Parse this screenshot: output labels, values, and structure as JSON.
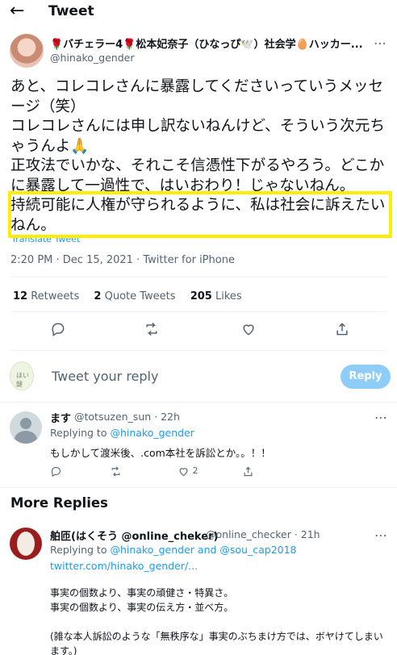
{
  "header": {
    "title": "Tweet",
    "back_icon": "back-arrow-icon"
  },
  "tweet": {
    "display_name": "🌹バチェラー4🌹松本妃奈子（ひなっぴ🕊️）社会学🥚ハッカー...",
    "handle": "@hinako_gender",
    "text_lines": [
      "あと、コレコレさんに暴露してくださいっていうメッセージ（笑）",
      "コレコレさんには申し訳ないねんけど、そういう次元ちゃうんよ🙏",
      "正攻法でいかな、それこそ信憑性下がるやろう。どこかに暴露して一過性で、はいおわり！じゃないねん。",
      "持続可能に人権が守られるように、私は社会に訴えたいねん。"
    ],
    "translate_label": "Translate Tweet",
    "meta": "2:20 PM · Dec 15, 2021 · Twitter for iPhone",
    "stats": {
      "retweets_count": "12",
      "retweets_label": "Retweets",
      "quotes_count": "2",
      "quotes_label": "Quote Tweets",
      "likes_count": "205",
      "likes_label": "Likes"
    },
    "highlight_color": "#ffee00"
  },
  "reply_composer": {
    "avatar_text": "ほい 鍵",
    "placeholder": "Tweet your reply",
    "button_label": "Reply"
  },
  "replies": [
    {
      "name": "ます",
      "handle_time": "@totsuzen_sun · 22h",
      "replying_prefix": "Replying to ",
      "replying_to": "@hinako_gender",
      "text": "もしかして渡米後、.com本社を訴訟とか。。！！",
      "like_count": "2"
    }
  ],
  "more_replies": {
    "title": "More Replies",
    "items": [
      {
        "name": "舶匝(はくそう @online_cheker)",
        "handle_time": "@online_checker · 21h",
        "replying_prefix": "Replying to ",
        "replying_to": "@hinako_gender and @sou_cap2018",
        "link": "twitter.com/hinako_gender/...",
        "body_lines": [
          "事実の個数より、事実の頑健さ・特異さ。",
          "事実の個数より、事実の伝え方・並べ方。",
          "",
          "(雑な本人訴訟のような「無秩序な」事実のぶちまけ方では、ボヤけてしまいます。)"
        ]
      }
    ]
  },
  "colors": {
    "accent": "#1d9bf0",
    "text": "#0f1419",
    "muted": "#536471",
    "reply_button": "#8ecdf8"
  }
}
